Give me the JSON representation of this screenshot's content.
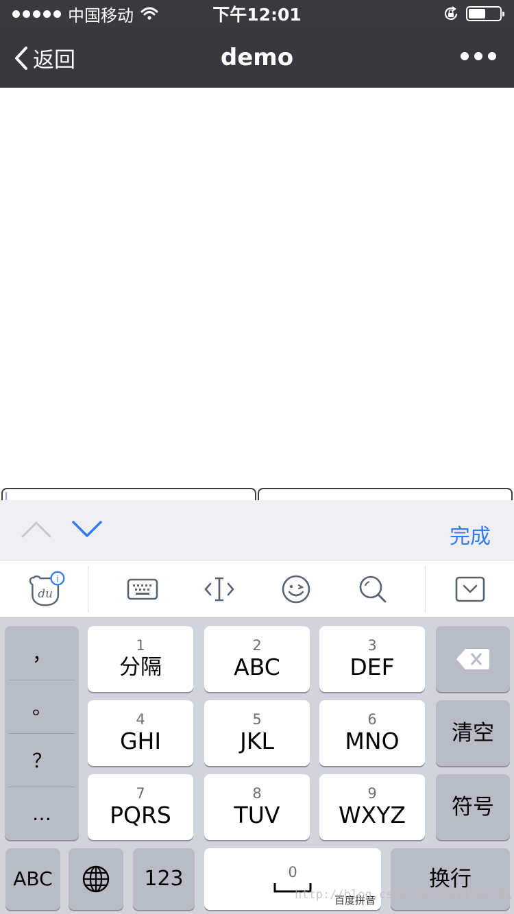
{
  "status_bar": {
    "carrier": "中国移动",
    "time": "下午12:01",
    "battery_level": 0.55
  },
  "nav": {
    "back_label": "返回",
    "title": "demo"
  },
  "accessory": {
    "done_label": "完成"
  },
  "keyboard": {
    "punctuation": [
      "，",
      "。",
      "？",
      "…"
    ],
    "keys": [
      {
        "num": "1",
        "label": "分隔"
      },
      {
        "num": "2",
        "label": "ABC"
      },
      {
        "num": "3",
        "label": "DEF"
      },
      {
        "num": "4",
        "label": "GHI"
      },
      {
        "num": "5",
        "label": "JKL"
      },
      {
        "num": "6",
        "label": "MNO"
      },
      {
        "num": "7",
        "label": "PQRS"
      },
      {
        "num": "8",
        "label": "TUV"
      },
      {
        "num": "9",
        "label": "WXYZ"
      }
    ],
    "clear_label": "清空",
    "symbol_label": "符号",
    "abc_label": "ABC",
    "num_label": "123",
    "space_num": "0",
    "space_sub": "百度拼音",
    "enter_label": "换行",
    "watermark": "http://blog.csdn.net/u011500781"
  },
  "icons": {
    "brand": "baidu-du-icon",
    "toolbar": [
      "keyboard-icon",
      "cursor-move-icon",
      "emoji-icon",
      "search-icon",
      "collapse-keyboard-icon"
    ],
    "delete": "backspace-icon",
    "globe": "globe-icon"
  },
  "colors": {
    "nav_bg": "#39393d",
    "accent": "#2f7cf6",
    "keyboard_bg": "#d1d4da",
    "dark_key": "#b8bcc7"
  }
}
